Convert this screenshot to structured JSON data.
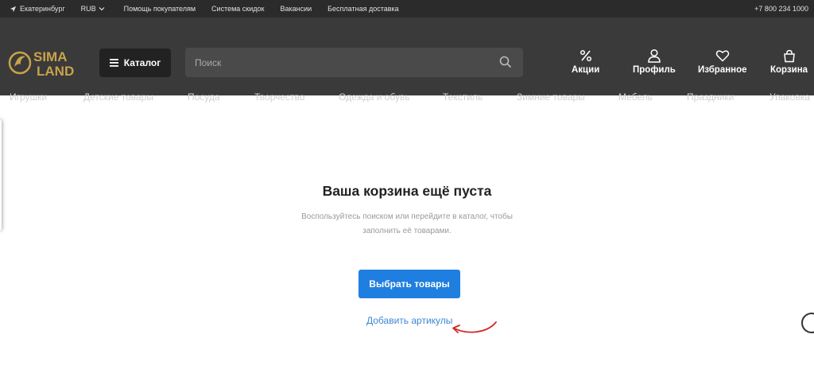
{
  "topbar": {
    "city": "Екатеринбург",
    "currency": "RUB",
    "links": [
      "Помощь покупателям",
      "Система скидок",
      "Вакансии",
      "Бесплатная доставка"
    ],
    "phone": "+7 800 234 1000"
  },
  "header": {
    "logo_line1": "SIMA",
    "logo_line2": "LAND",
    "catalog_label": "Каталог",
    "search_placeholder": "Поиск",
    "actions": [
      "Акции",
      "Профиль",
      "Избранное",
      "Корзина"
    ]
  },
  "nav": [
    "Игрушки",
    "Детские товары",
    "Посуда",
    "Творчество",
    "Одежда и обувь",
    "Текстиль",
    "Зимние товары",
    "Мебель",
    "Праздники",
    "Упаковка"
  ],
  "cart": {
    "title": "Ваша корзина ещё пуста",
    "subtitle": "Воспользуйтесь поиском или перейдите в каталог, чтобы заполнить её товарами.",
    "choose_button": "Выбрать товары",
    "add_articles_link": "Добавить артикулы"
  },
  "colors": {
    "accent": "#1f7fe0",
    "link": "#3f86d6",
    "logo_gold": "#c9a24a",
    "annotation_arrow": "#d22a2a"
  }
}
